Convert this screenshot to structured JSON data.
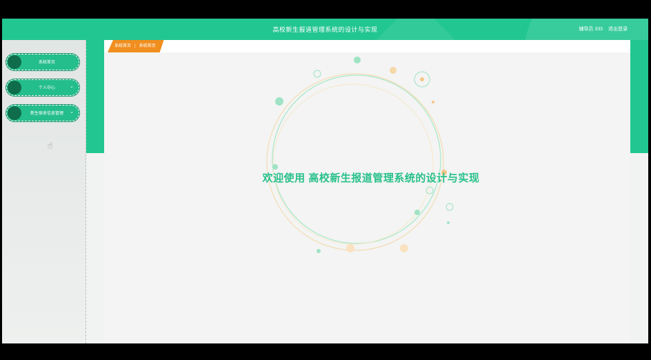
{
  "header": {
    "title": "高校新生报道管理系统的设计与实现",
    "user_name": "辅导员 333",
    "logout_label": "退出登录"
  },
  "breadcrumb": {
    "items": [
      "系统首页",
      "系统首页"
    ],
    "separator": "|"
  },
  "sidebar": {
    "items": [
      {
        "label": "系统首页",
        "has_submenu": false
      },
      {
        "label": "个人中心",
        "has_submenu": true
      },
      {
        "label": "新生宿舍信息管理",
        "has_submenu": true
      }
    ],
    "chevron": "⌄"
  },
  "main": {
    "welcome_text": "欢迎使用 高校新生报道管理系统的设计与实现"
  },
  "colors": {
    "primary": "#22c691",
    "accent": "#f08e1e",
    "dark_green": "#0f6d4b"
  }
}
